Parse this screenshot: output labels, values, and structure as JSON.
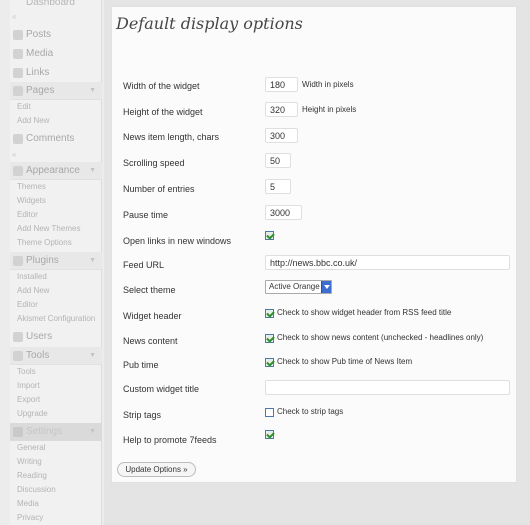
{
  "sidebar": {
    "top_item": "Dashboard",
    "separator": "«",
    "menus": [
      {
        "label": "Posts",
        "icon": "pushpin-icon"
      },
      {
        "label": "Media",
        "icon": "media-icon"
      },
      {
        "label": "Links",
        "icon": "link-icon"
      },
      {
        "label": "Pages",
        "icon": "pages-icon"
      },
      {
        "label": "Comments",
        "icon": "comments-icon"
      },
      {
        "label": "Appearance",
        "icon": "appearance-icon"
      },
      {
        "label": "Plugins",
        "icon": "plugins-icon"
      },
      {
        "label": "Users",
        "icon": "users-icon"
      },
      {
        "label": "Tools",
        "icon": "tools-icon"
      },
      {
        "label": "Settings",
        "icon": "settings-icon"
      }
    ],
    "pages_sub": [
      "Edit",
      "Add New"
    ],
    "appearance_sub": [
      "Themes",
      "Widgets",
      "Editor",
      "Add New Themes",
      "Theme Options"
    ],
    "plugins_sub": [
      "Installed",
      "Add New",
      "Editor",
      "Akismet Configuration"
    ],
    "tools_sub": [
      "Tools",
      "Import",
      "Export",
      "Upgrade"
    ],
    "settings_sub": [
      "General",
      "Writing",
      "Reading",
      "Discussion",
      "Media",
      "Privacy"
    ]
  },
  "form": {
    "title": "Default display options",
    "width_label": "Width of the widget",
    "width_value": "180",
    "width_hint": "Width in pixels",
    "height_label": "Height of the widget",
    "height_value": "320",
    "height_hint": "Height in pixels",
    "news_len_label": "News item length, chars",
    "news_len_value": "300",
    "speed_label": "Scrolling speed",
    "speed_value": "50",
    "entries_label": "Number of entries",
    "entries_value": "5",
    "pause_label": "Pause time",
    "pause_value": "3000",
    "newwin_label": "Open links in new windows",
    "newwin_checked": true,
    "feed_label": "Feed URL",
    "feed_value": "http://news.bbc.co.uk/",
    "theme_label": "Select theme",
    "theme_value": "Active Orange",
    "header_label": "Widget header",
    "header_hint": "Check to show widget header from RSS feed title",
    "content_label": "News content",
    "content_hint": "Check to show news content (unchecked - headlines only)",
    "pubtime_label": "Pub time",
    "pubtime_hint": "Check to show Pub time of News Item",
    "custom_title_label": "Custom widget title",
    "custom_title_value": "",
    "strip_label": "Strip tags",
    "strip_hint": "Check to strip tags",
    "promote_label": "Help to promote 7feeds",
    "update_button": "Update Options »"
  },
  "colors": {
    "panel_bg": "#fbfbfb",
    "page_bg": "#e4e4e4",
    "select_arrow": "#3d6dd1",
    "check_green": "#2f8f2f"
  }
}
